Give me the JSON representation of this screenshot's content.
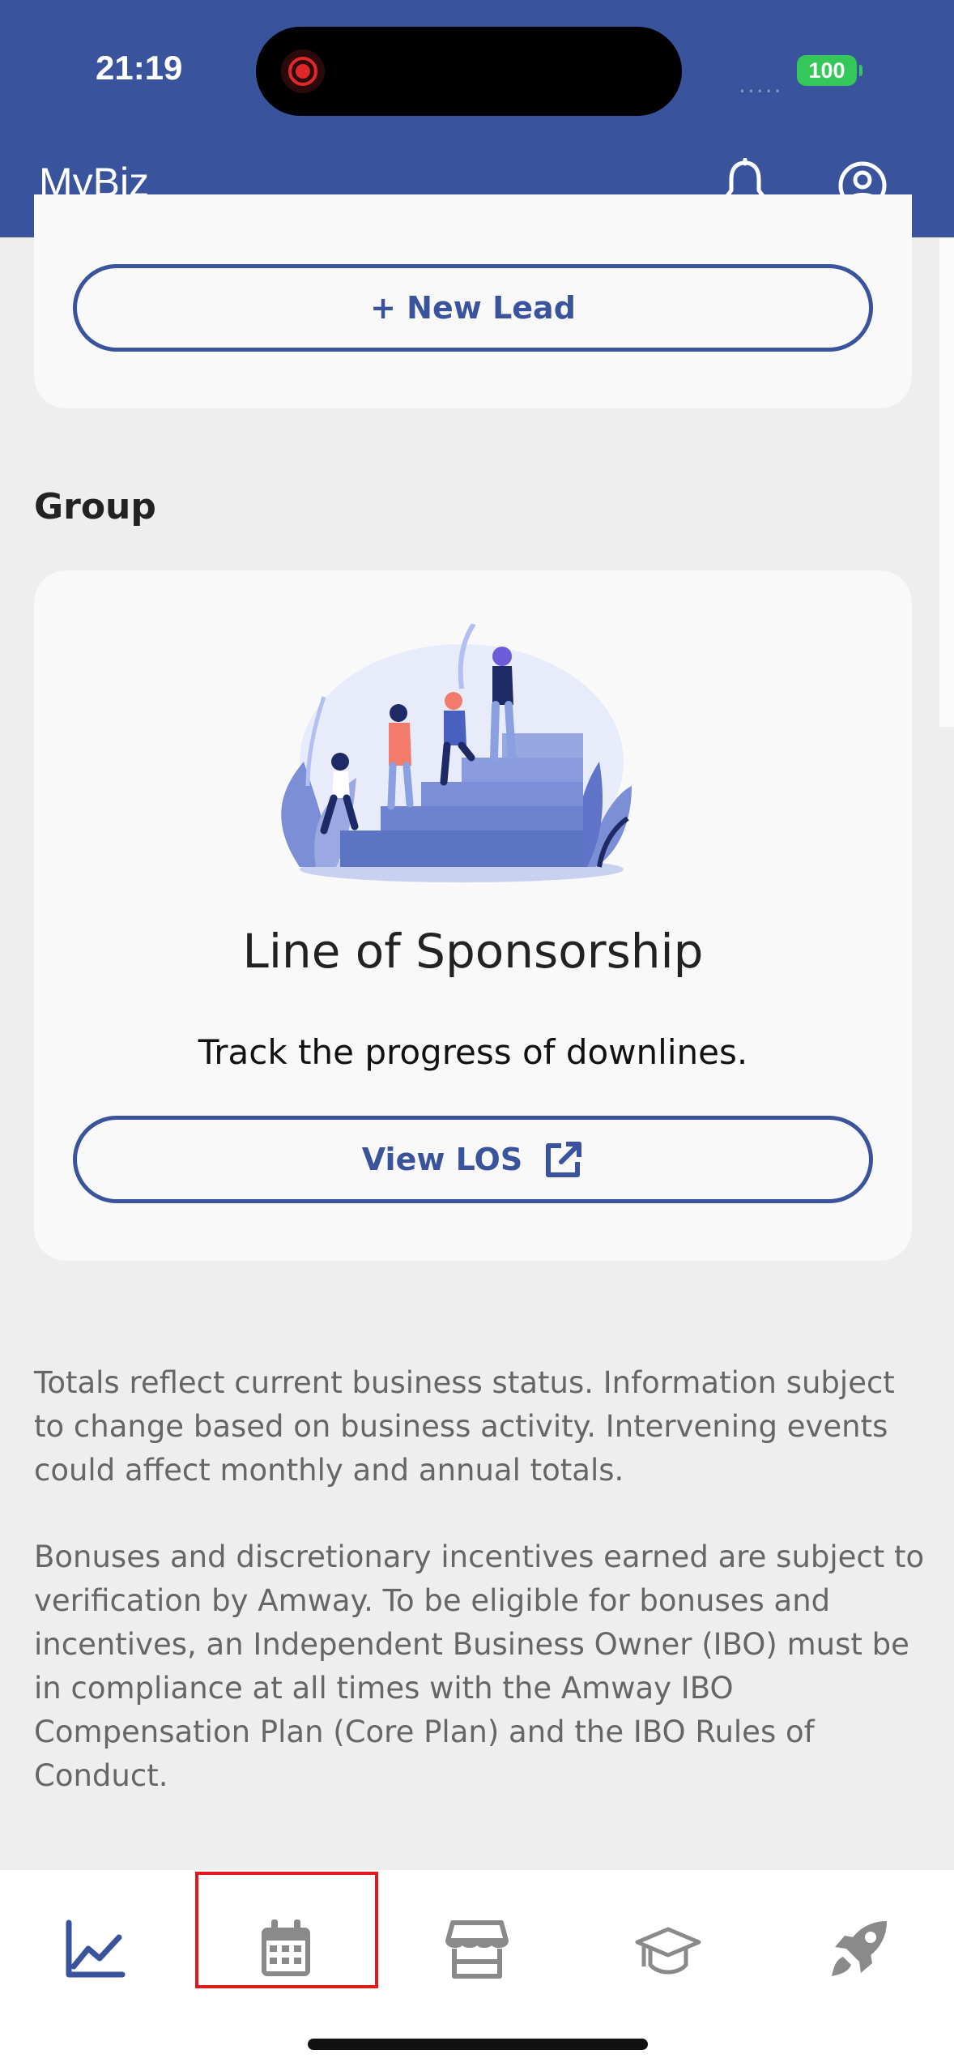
{
  "status_bar": {
    "time": "21:19",
    "battery": "100",
    "signal": "....."
  },
  "header": {
    "title": "MyBiz",
    "icons": [
      "bell-icon",
      "profile-icon"
    ]
  },
  "leads": {
    "new_lead_label": "+ New Lead"
  },
  "group": {
    "section_title": "Group",
    "card": {
      "heading": "Line of Sponsorship",
      "subtitle": "Track the progress of downlines.",
      "button_label": "View LOS",
      "button_icon": "external-link-icon"
    }
  },
  "disclaimers": [
    "Totals reflect current business status. Information subject to change based on business activity. Intervening events could affect monthly and annual totals.",
    "Bonuses and discretionary incentives earned are subject to verification by Amway. To be eligible for bonuses and incentives, an Independent Business Owner (IBO) must be in compliance at all times with the Amway IBO Compensation Plan (Core Plan) and the IBO Rules of Conduct."
  ],
  "tabbar": {
    "tabs": [
      {
        "icon": "chart-line-icon",
        "active": true
      },
      {
        "icon": "calendar-icon",
        "active": false,
        "highlighted": true
      },
      {
        "icon": "store-icon",
        "active": false
      },
      {
        "icon": "graduation-cap-icon",
        "active": false
      },
      {
        "icon": "rocket-icon",
        "active": false
      }
    ]
  },
  "colors": {
    "brand": "#39539c",
    "background": "#eeeeee",
    "card": "#f9f9f9",
    "highlight": "#e01b1b",
    "inactive_icon": "#888888"
  }
}
